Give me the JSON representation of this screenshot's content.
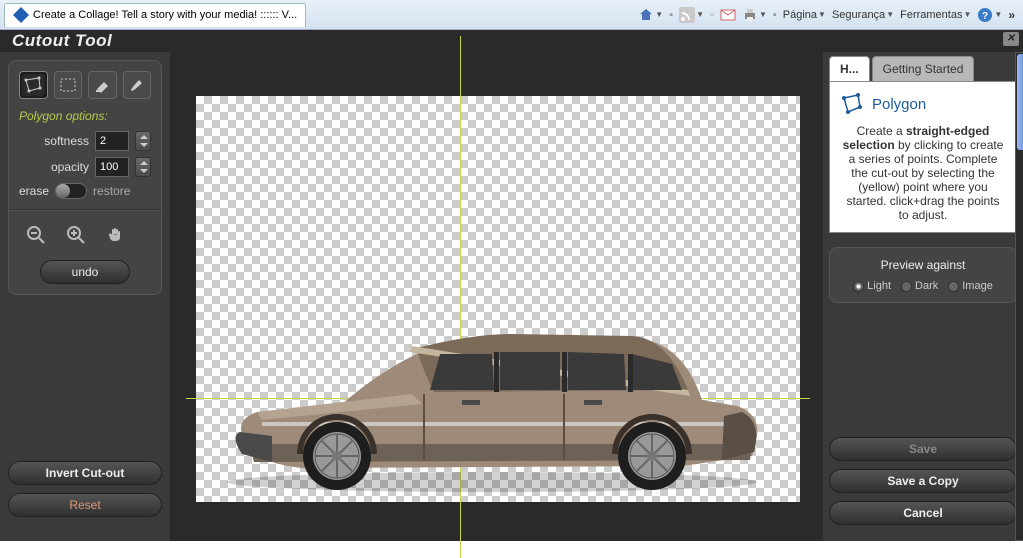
{
  "browser": {
    "tab_title": "Create a Collage! Tell a story with your media! :::::: V...",
    "menu_pagina": "Página",
    "menu_seguranca": "Segurança",
    "menu_ferramentas": "Ferramentas"
  },
  "app": {
    "window_title": "Cutout Tool"
  },
  "toolbar": {
    "options_header": "Polygon options:",
    "softness_label": "softness",
    "softness_value": "2",
    "opacity_label": "opacity",
    "opacity_value": "100",
    "erase_label": "erase",
    "restore_label": "restore",
    "undo_label": "undo"
  },
  "left_actions": {
    "invert_label": "Invert Cut-out",
    "reset_label": "Reset"
  },
  "help": {
    "tab_active": "H...",
    "tab_other": "Getting Started",
    "title": "Polygon",
    "text_prefix": "Create a ",
    "text_bold": "straight-edged selection",
    "text_rest": " by clicking to create a series of points. Complete the cut-out by selecting the (yellow) point where you started. click+drag the points to adjust."
  },
  "preview": {
    "title": "Preview against",
    "opt_light": "Light",
    "opt_dark": "Dark",
    "opt_image": "Image"
  },
  "right_actions": {
    "save": "Save",
    "save_copy": "Save a Copy",
    "cancel": "Cancel"
  }
}
